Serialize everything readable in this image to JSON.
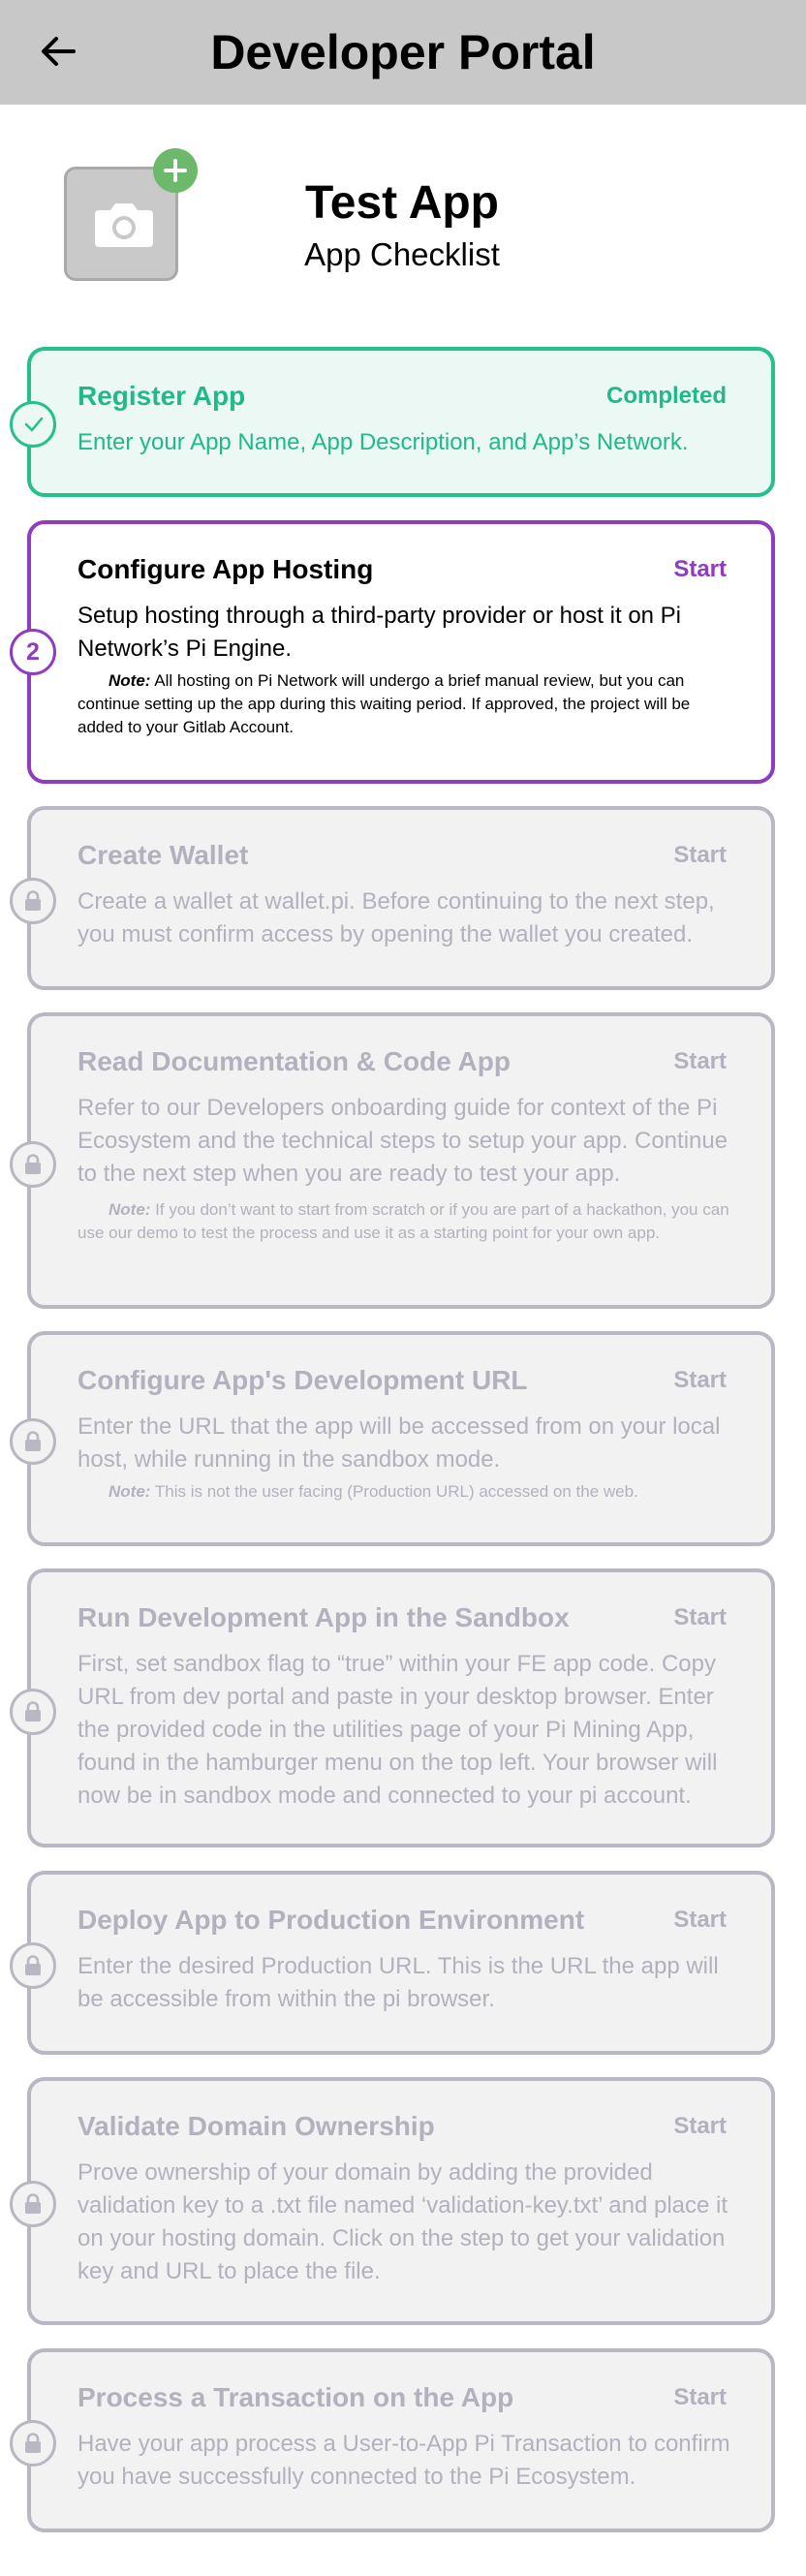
{
  "header": {
    "title": "Developer Portal"
  },
  "app": {
    "name": "Test App",
    "subtitle": "App Checklist"
  },
  "steps": [
    {
      "title": "Register App",
      "status": "Completed",
      "state": "completed",
      "description": "Enter your App Name, App Description, and App’s Network."
    },
    {
      "title": "Configure App Hosting",
      "status": "Start",
      "state": "active",
      "number": "2",
      "description": "Setup hosting through a third-party provider or host it on Pi Network’s Pi Engine.",
      "note_label": "Note:",
      "note_text": " All hosting on Pi Network will undergo a brief manual review, but you can continue setting up the app during this waiting period. If approved, the project will be added to your Gitlab Account."
    },
    {
      "title": "Create Wallet",
      "status": "Start",
      "state": "locked",
      "description": "Create a wallet at wallet.pi. Before continuing to the next step, you must confirm access by opening the wallet you created."
    },
    {
      "title": "Read Documentation & Code App",
      "status": "Start",
      "state": "locked",
      "description": "Refer to our Developers onboarding guide for context of the Pi Ecosystem and the technical steps to setup your app. Continue to the next step when you are ready to test your app.",
      "note_label": "Note:",
      "note_text": " If you don’t want to start from scratch or if you are part of a hackathon, you can use our demo to test the process and use it as a starting point for your own app."
    },
    {
      "title": "Configure App's Development URL",
      "status": "Start",
      "state": "locked",
      "description": "Enter the URL that the app will be accessed from on your local host, while running in the sandbox mode.",
      "note_label": "Note:",
      "note_text": " This is not the user facing (Production URL) accessed on the web."
    },
    {
      "title": "Run Development App in the Sandbox",
      "status": "Start",
      "state": "locked",
      "description": "First, set sandbox flag to “true” within your FE app code. Copy URL from dev portal and paste in your desktop browser. Enter the provided code in the utilities page of your Pi Mining App, found in the hamburger menu on the top left. Your browser will now be in sandbox mode and connected to your pi account."
    },
    {
      "title": "Deploy App to Production Environment",
      "status": "Start",
      "state": "locked",
      "description": "Enter the desired Production URL. This is the URL the app will be accessible from within the pi browser."
    },
    {
      "title": "Validate Domain Ownership",
      "status": "Start",
      "state": "locked",
      "description": "Prove ownership of your domain by adding the provided validation key to a .txt file named ‘validation-key.txt’ and place it on your hosting domain. Click on the step to get your validation key and URL to place the file."
    },
    {
      "title": "Process a Transaction on the App",
      "status": "Start",
      "state": "locked",
      "description": "Have your app process a User-to-App Pi Transaction to confirm you have successfully connected to the Pi Ecosystem."
    }
  ],
  "icons": {
    "back": "arrow-left-icon",
    "photo": "camera-icon",
    "add": "plus-icon",
    "done": "check-icon",
    "locked": "lock-icon"
  },
  "colors": {
    "completed": "#25c08c",
    "active": "#8f3cc2",
    "locked": "#b8b7c2",
    "add_badge": "#6cb96b",
    "header": "#c8c8c8"
  }
}
